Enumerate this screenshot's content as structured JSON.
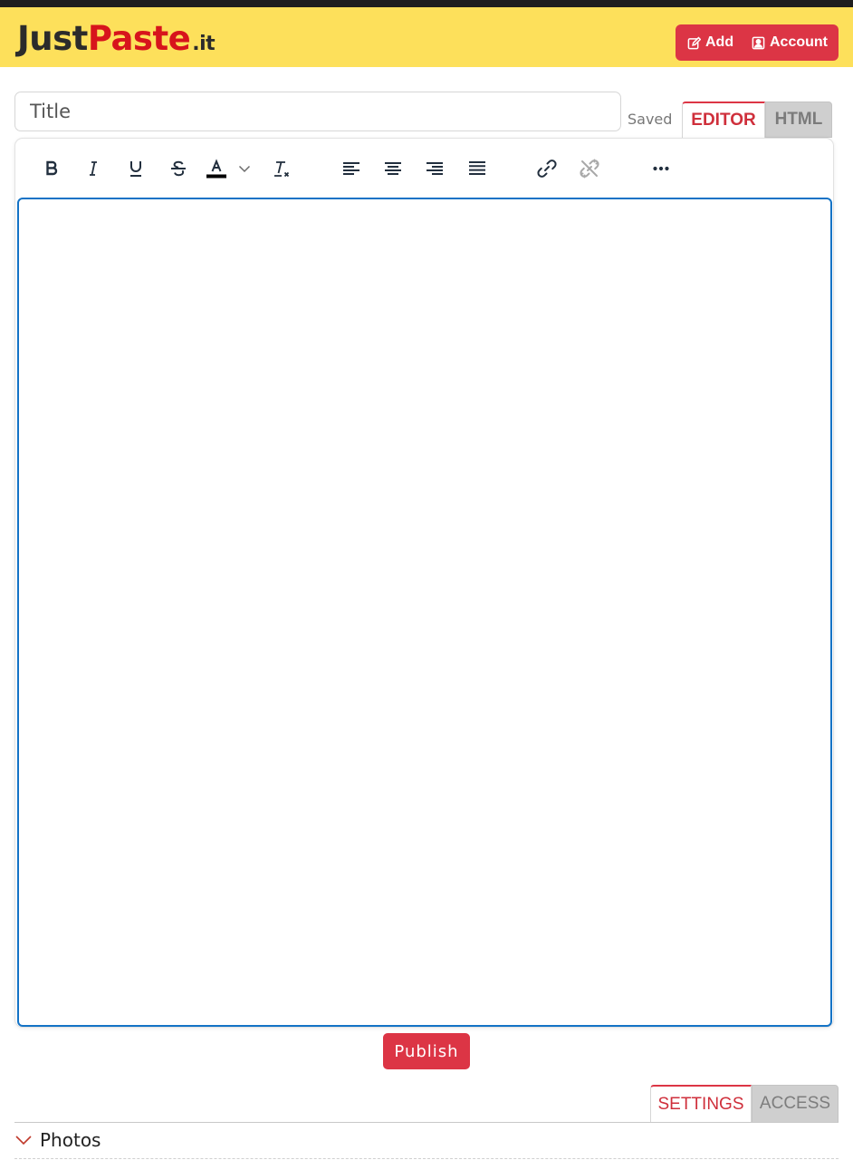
{
  "header": {
    "logo": {
      "just": "Just",
      "paste": "Paste",
      "it": ".it"
    },
    "buttons": {
      "add_label": "Add",
      "account_label": "Account"
    }
  },
  "editor": {
    "title_placeholder": "Title",
    "status": "Saved",
    "mode_tabs": {
      "editor": "EDITOR",
      "html": "HTML"
    },
    "toolbar": [
      {
        "name": "bold",
        "icon": "bold-icon"
      },
      {
        "name": "italic",
        "icon": "italic-icon"
      },
      {
        "name": "underline",
        "icon": "underline-icon"
      },
      {
        "name": "strikethrough",
        "icon": "strikethrough-icon"
      },
      {
        "name": "text-color",
        "icon": "text-color-icon"
      },
      {
        "name": "text-color-dropdown",
        "icon": "chevron-down-icon"
      },
      {
        "name": "clear-formatting",
        "icon": "remove-format-icon"
      },
      {
        "name": "align-left",
        "icon": "align-left-icon"
      },
      {
        "name": "align-center",
        "icon": "align-center-icon"
      },
      {
        "name": "align-right",
        "icon": "align-right-icon"
      },
      {
        "name": "justify",
        "icon": "align-justify-icon"
      },
      {
        "name": "insert-link",
        "icon": "link-icon"
      },
      {
        "name": "remove-link",
        "icon": "unlink-icon"
      },
      {
        "name": "more",
        "icon": "more-horizontal-icon"
      }
    ],
    "content": ""
  },
  "actions": {
    "publish_label": "Publish"
  },
  "settings": {
    "tabs": {
      "settings": "SETTINGS",
      "access": "ACCESS"
    },
    "sections": {
      "photos": "Photos"
    }
  },
  "colors": {
    "header_bg": "#fde05b",
    "brand_red": "#dc3545",
    "logo_red": "#d7141c",
    "editor_focus_border": "#1473c6"
  }
}
